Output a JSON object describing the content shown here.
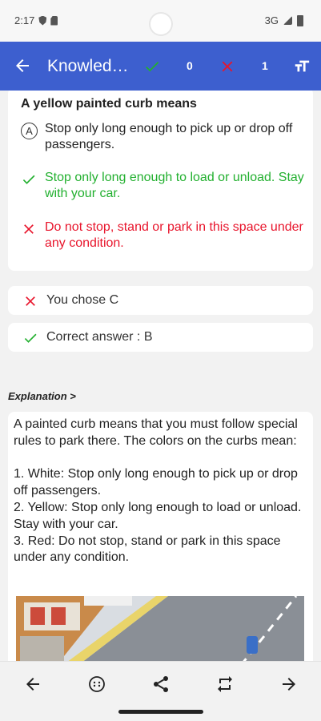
{
  "status": {
    "time": "2:17",
    "network": "3G"
  },
  "appbar": {
    "title": "Knowled…",
    "correct_count": "0",
    "wrong_count": "1",
    "icons": {
      "back": "arrow-left-icon",
      "correct": "check-icon",
      "wrong": "x-icon",
      "text_size": "text-size-icon"
    }
  },
  "question": {
    "title": "A yellow painted curb means",
    "options": [
      {
        "letter": "A",
        "text": "Stop only long enough to pick up or drop off passengers.",
        "state": "neutral"
      },
      {
        "text": "Stop only long enough to load or unload. Stay with your car.",
        "state": "correct"
      },
      {
        "text": "Do not stop, stand or park in this space under any condition.",
        "state": "wrong"
      }
    ]
  },
  "result": {
    "chose": "You chose C",
    "correct": "Correct answer : B"
  },
  "explanation": {
    "heading": "Explanation >",
    "body": "A painted curb means that you must follow special rules to park there. The colors on the curbs mean:\n\n1. White: Stop only long enough to pick up or drop off passengers.\n2. Yellow: Stop only long enough to load or unload. Stay with your car.\n3. Red: Do not stop, stand or park in this space under any condition."
  },
  "colors": {
    "primary": "#3d5fcf",
    "correct": "#22b02f",
    "wrong": "#e8152c"
  },
  "bottom_nav": [
    "arrow-left-icon",
    "options-icon",
    "share-icon",
    "repeat-icon",
    "arrow-right-icon"
  ]
}
